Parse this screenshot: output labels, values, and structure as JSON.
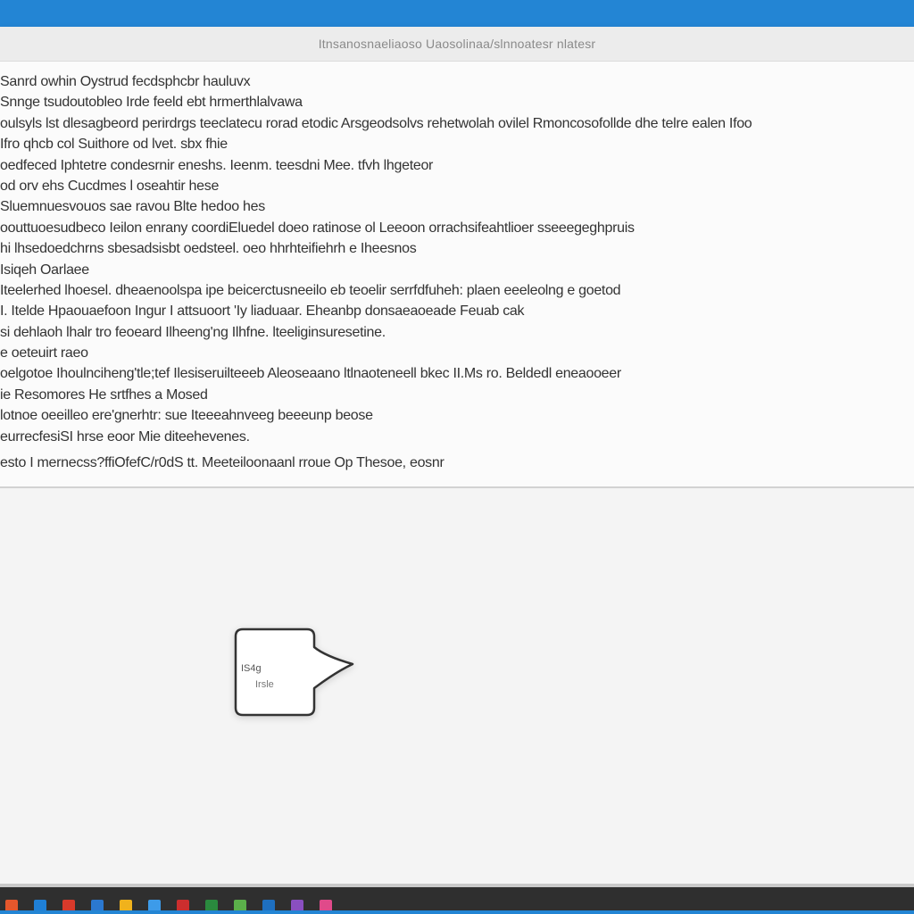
{
  "window": {
    "title": "Itnsanosnaeliaoso Uaosolinaa/slnnoatesr nlatesr",
    "lines": [
      "Sanrd owhin Oystrud fecdsphcbr hauluvx",
      "Snnge tsudoutobleo Irde feeld ebt hrmerthlalvawa",
      "oulsyls lst dlesagbeord perirdrgs teeclatecu rorad etodic Arsgeodsolvs rehetwolah ovilel Rmoncosofollde dhe telre ealen Ifoo",
      "Ifro qhcb col Suithore od lvet. sbx fhie",
      "oedfeced Iphtetre condesrnir eneshs. Ieenm. teesdni Mee. tfvh lhgeteor",
      "od orv ehs Cucdmes l oseahtir hese",
      "Sluemnuesvouos sae ravou Blte hedoo hes",
      "oouttuoesudbeco Ieilon enrany coordiEluedel doeo ratinose ol Leeoon orrachsifeahtlioer sseeegeghpruis",
      "hi lhsedoedchrns sbesadsisbt oedsteel. oeo hhrhteifiehrh e Iheesnos",
      "Isiqeh Oarlaee",
      "Iteelerhed lhoesel. dheaenoolspa ipe beicerctusneeilo eb teoelir serrfdfuheh: plaen eeeleolng e goetod",
      "I. Itelde Hpaouaefoon Ingur I attsuoort 'Iy liaduaar. Eheanbp donsaeaoeade Feuab cak",
      "si dehlaoh lhalr tro feoeard Ilheeng'ng Ilhfne. lteeliginsuresetine.",
      "e oeteuirt raeo",
      "oelgotoe Ihoulnciheng'tle;tef Ilesiseruilteeeb Aleoseaano ltlnaoteneell bkec II.Ms ro. Beldedl eneaooeer",
      "ie Resomores He srtfhes a Mosed",
      "lotnoe oeeilleo ere'gnerhtr: sue Iteeeahnveeg beeeunp beose",
      "eurrecfesiSI hrse eoor Mie diteehevenes.",
      "esto I mernecss?ffiOfefC/r0dS tt. Meeteiloonaanl rroue Op Thesoe, eosnr"
    ]
  },
  "callout": {
    "line1": "IS4g",
    "line2": "Irsle"
  },
  "taskbar": {
    "icons": [
      {
        "name": "app-icon",
        "color": "#e5572c"
      },
      {
        "name": "app-icon",
        "color": "#1f7fd6"
      },
      {
        "name": "app-icon",
        "color": "#d93a2b"
      },
      {
        "name": "app-icon",
        "color": "#2b78d0"
      },
      {
        "name": "app-icon",
        "color": "#f0b21c"
      },
      {
        "name": "app-icon",
        "color": "#3d9be9"
      },
      {
        "name": "app-icon",
        "color": "#cc2e2e"
      },
      {
        "name": "app-icon",
        "color": "#2a8a3e"
      },
      {
        "name": "app-icon",
        "color": "#5bb04a"
      },
      {
        "name": "app-icon",
        "color": "#1e6fc0"
      },
      {
        "name": "app-icon",
        "color": "#8a4fc0"
      },
      {
        "name": "app-icon",
        "color": "#e04a8a"
      }
    ]
  },
  "colors": {
    "accent": "#2385d4",
    "taskbar": "#2f2f2f",
    "text": "#333333"
  }
}
